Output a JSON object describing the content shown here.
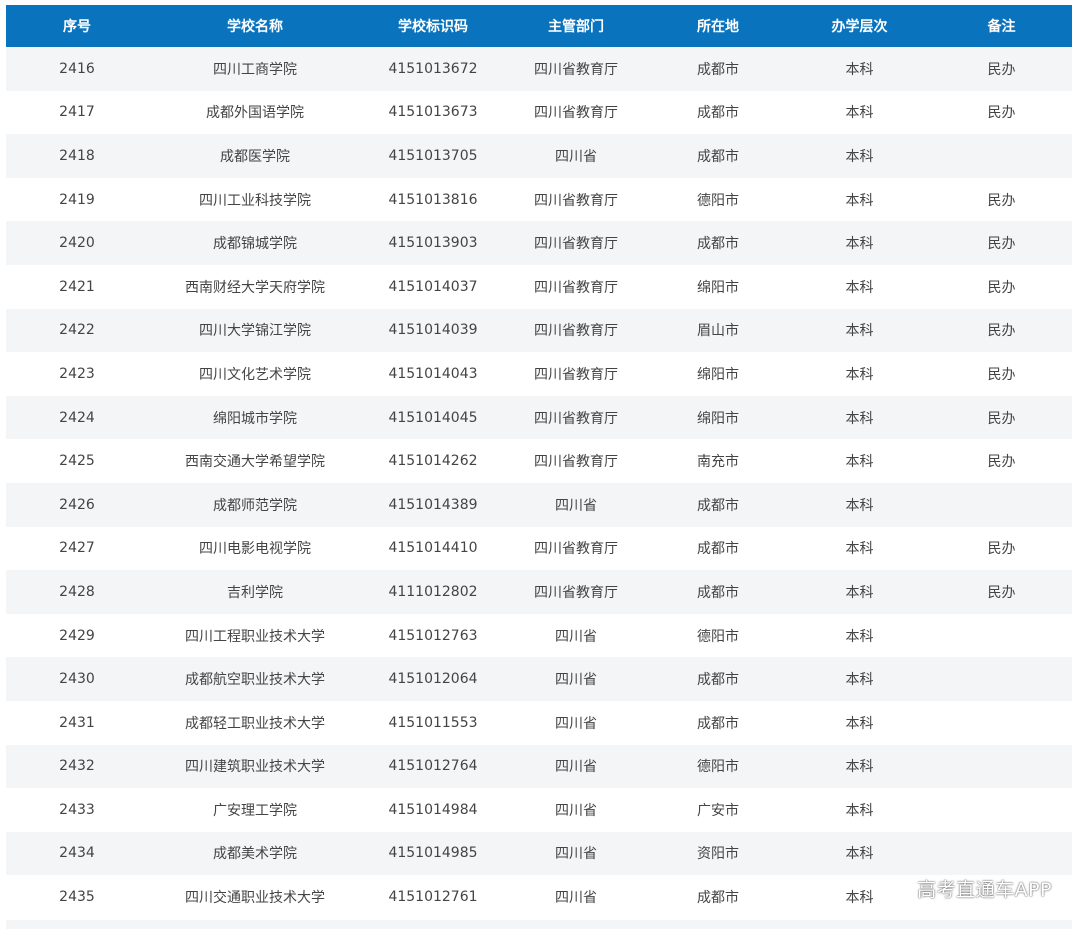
{
  "table": {
    "headers": [
      "序号",
      "学校名称",
      "学校标识码",
      "主管部门",
      "所在地",
      "办学层次",
      "备注"
    ],
    "rows": [
      [
        "2416",
        "四川工商学院",
        "4151013672",
        "四川省教育厅",
        "成都市",
        "本科",
        "民办"
      ],
      [
        "2417",
        "成都外国语学院",
        "4151013673",
        "四川省教育厅",
        "成都市",
        "本科",
        "民办"
      ],
      [
        "2418",
        "成都医学院",
        "4151013705",
        "四川省",
        "成都市",
        "本科",
        ""
      ],
      [
        "2419",
        "四川工业科技学院",
        "4151013816",
        "四川省教育厅",
        "德阳市",
        "本科",
        "民办"
      ],
      [
        "2420",
        "成都锦城学院",
        "4151013903",
        "四川省教育厅",
        "成都市",
        "本科",
        "民办"
      ],
      [
        "2421",
        "西南财经大学天府学院",
        "4151014037",
        "四川省教育厅",
        "绵阳市",
        "本科",
        "民办"
      ],
      [
        "2422",
        "四川大学锦江学院",
        "4151014039",
        "四川省教育厅",
        "眉山市",
        "本科",
        "民办"
      ],
      [
        "2423",
        "四川文化艺术学院",
        "4151014043",
        "四川省教育厅",
        "绵阳市",
        "本科",
        "民办"
      ],
      [
        "2424",
        "绵阳城市学院",
        "4151014045",
        "四川省教育厅",
        "绵阳市",
        "本科",
        "民办"
      ],
      [
        "2425",
        "西南交通大学希望学院",
        "4151014262",
        "四川省教育厅",
        "南充市",
        "本科",
        "民办"
      ],
      [
        "2426",
        "成都师范学院",
        "4151014389",
        "四川省",
        "成都市",
        "本科",
        ""
      ],
      [
        "2427",
        "四川电影电视学院",
        "4151014410",
        "四川省教育厅",
        "成都市",
        "本科",
        "民办"
      ],
      [
        "2428",
        "吉利学院",
        "4111012802",
        "四川省教育厅",
        "成都市",
        "本科",
        "民办"
      ],
      [
        "2429",
        "四川工程职业技术大学",
        "4151012763",
        "四川省",
        "德阳市",
        "本科",
        ""
      ],
      [
        "2430",
        "成都航空职业技术大学",
        "4151012064",
        "四川省",
        "成都市",
        "本科",
        ""
      ],
      [
        "2431",
        "成都轻工职业技术大学",
        "4151011553",
        "四川省",
        "成都市",
        "本科",
        ""
      ],
      [
        "2432",
        "四川建筑职业技术大学",
        "4151012764",
        "四川省",
        "德阳市",
        "本科",
        ""
      ],
      [
        "2433",
        "广安理工学院",
        "4151014984",
        "四川省",
        "广安市",
        "本科",
        ""
      ],
      [
        "2434",
        "成都美术学院",
        "4151014985",
        "四川省",
        "资阳市",
        "本科",
        ""
      ],
      [
        "2435",
        "四川交通职业技术大学",
        "4151012761",
        "四川省",
        "成都市",
        "本科",
        ""
      ]
    ]
  },
  "watermark": "高考直通车APP",
  "colors": {
    "header_bg": "#0a73bd",
    "header_text": "#ffffff",
    "row_alt_bg": "#f4f5f7",
    "cell_text": "#444444"
  }
}
